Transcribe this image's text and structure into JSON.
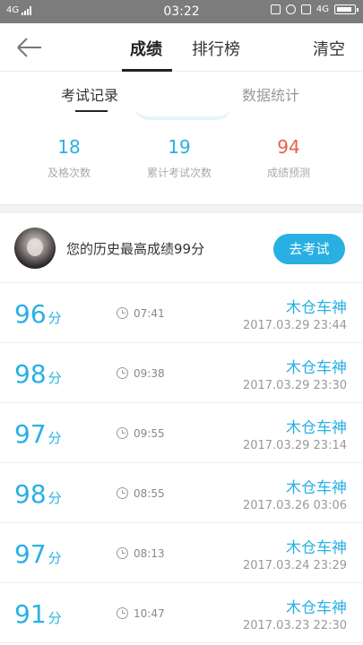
{
  "status_bar": {
    "network_left": "4G",
    "time": "03:22",
    "network_right": "4G"
  },
  "header": {
    "tabs": [
      {
        "label": "成绩"
      },
      {
        "label": "排行榜"
      }
    ],
    "clear_label": "清空"
  },
  "subtabs": [
    {
      "label": "考试记录"
    },
    {
      "label": "数据统计"
    }
  ],
  "stats": [
    {
      "value": "18",
      "label": "及格次数",
      "color": "#29b0e3"
    },
    {
      "value": "19",
      "label": "累计考试次数",
      "color": "#29b0e3"
    },
    {
      "value": "94",
      "label": "成绩预测",
      "color": "#e5614f"
    }
  ],
  "best": {
    "text": "您的历史最高成绩99分",
    "button_label": "去考试"
  },
  "records": [
    {
      "score": "96",
      "unit": "分",
      "duration": "07:41",
      "name": "木仓车神",
      "datetime": "2017.03.29  23:44"
    },
    {
      "score": "98",
      "unit": "分",
      "duration": "09:38",
      "name": "木仓车神",
      "datetime": "2017.03.29  23:30"
    },
    {
      "score": "97",
      "unit": "分",
      "duration": "09:55",
      "name": "木仓车神",
      "datetime": "2017.03.29  23:14"
    },
    {
      "score": "98",
      "unit": "分",
      "duration": "08:55",
      "name": "木仓车神",
      "datetime": "2017.03.26  03:06"
    },
    {
      "score": "97",
      "unit": "分",
      "duration": "08:13",
      "name": "木仓车神",
      "datetime": "2017.03.24  23:29"
    },
    {
      "score": "91",
      "unit": "分",
      "duration": "10:47",
      "name": "木仓车神",
      "datetime": "2017.03.23  22:30"
    }
  ],
  "colors": {
    "accent": "#29b0e3",
    "prediction": "#e5614f"
  }
}
